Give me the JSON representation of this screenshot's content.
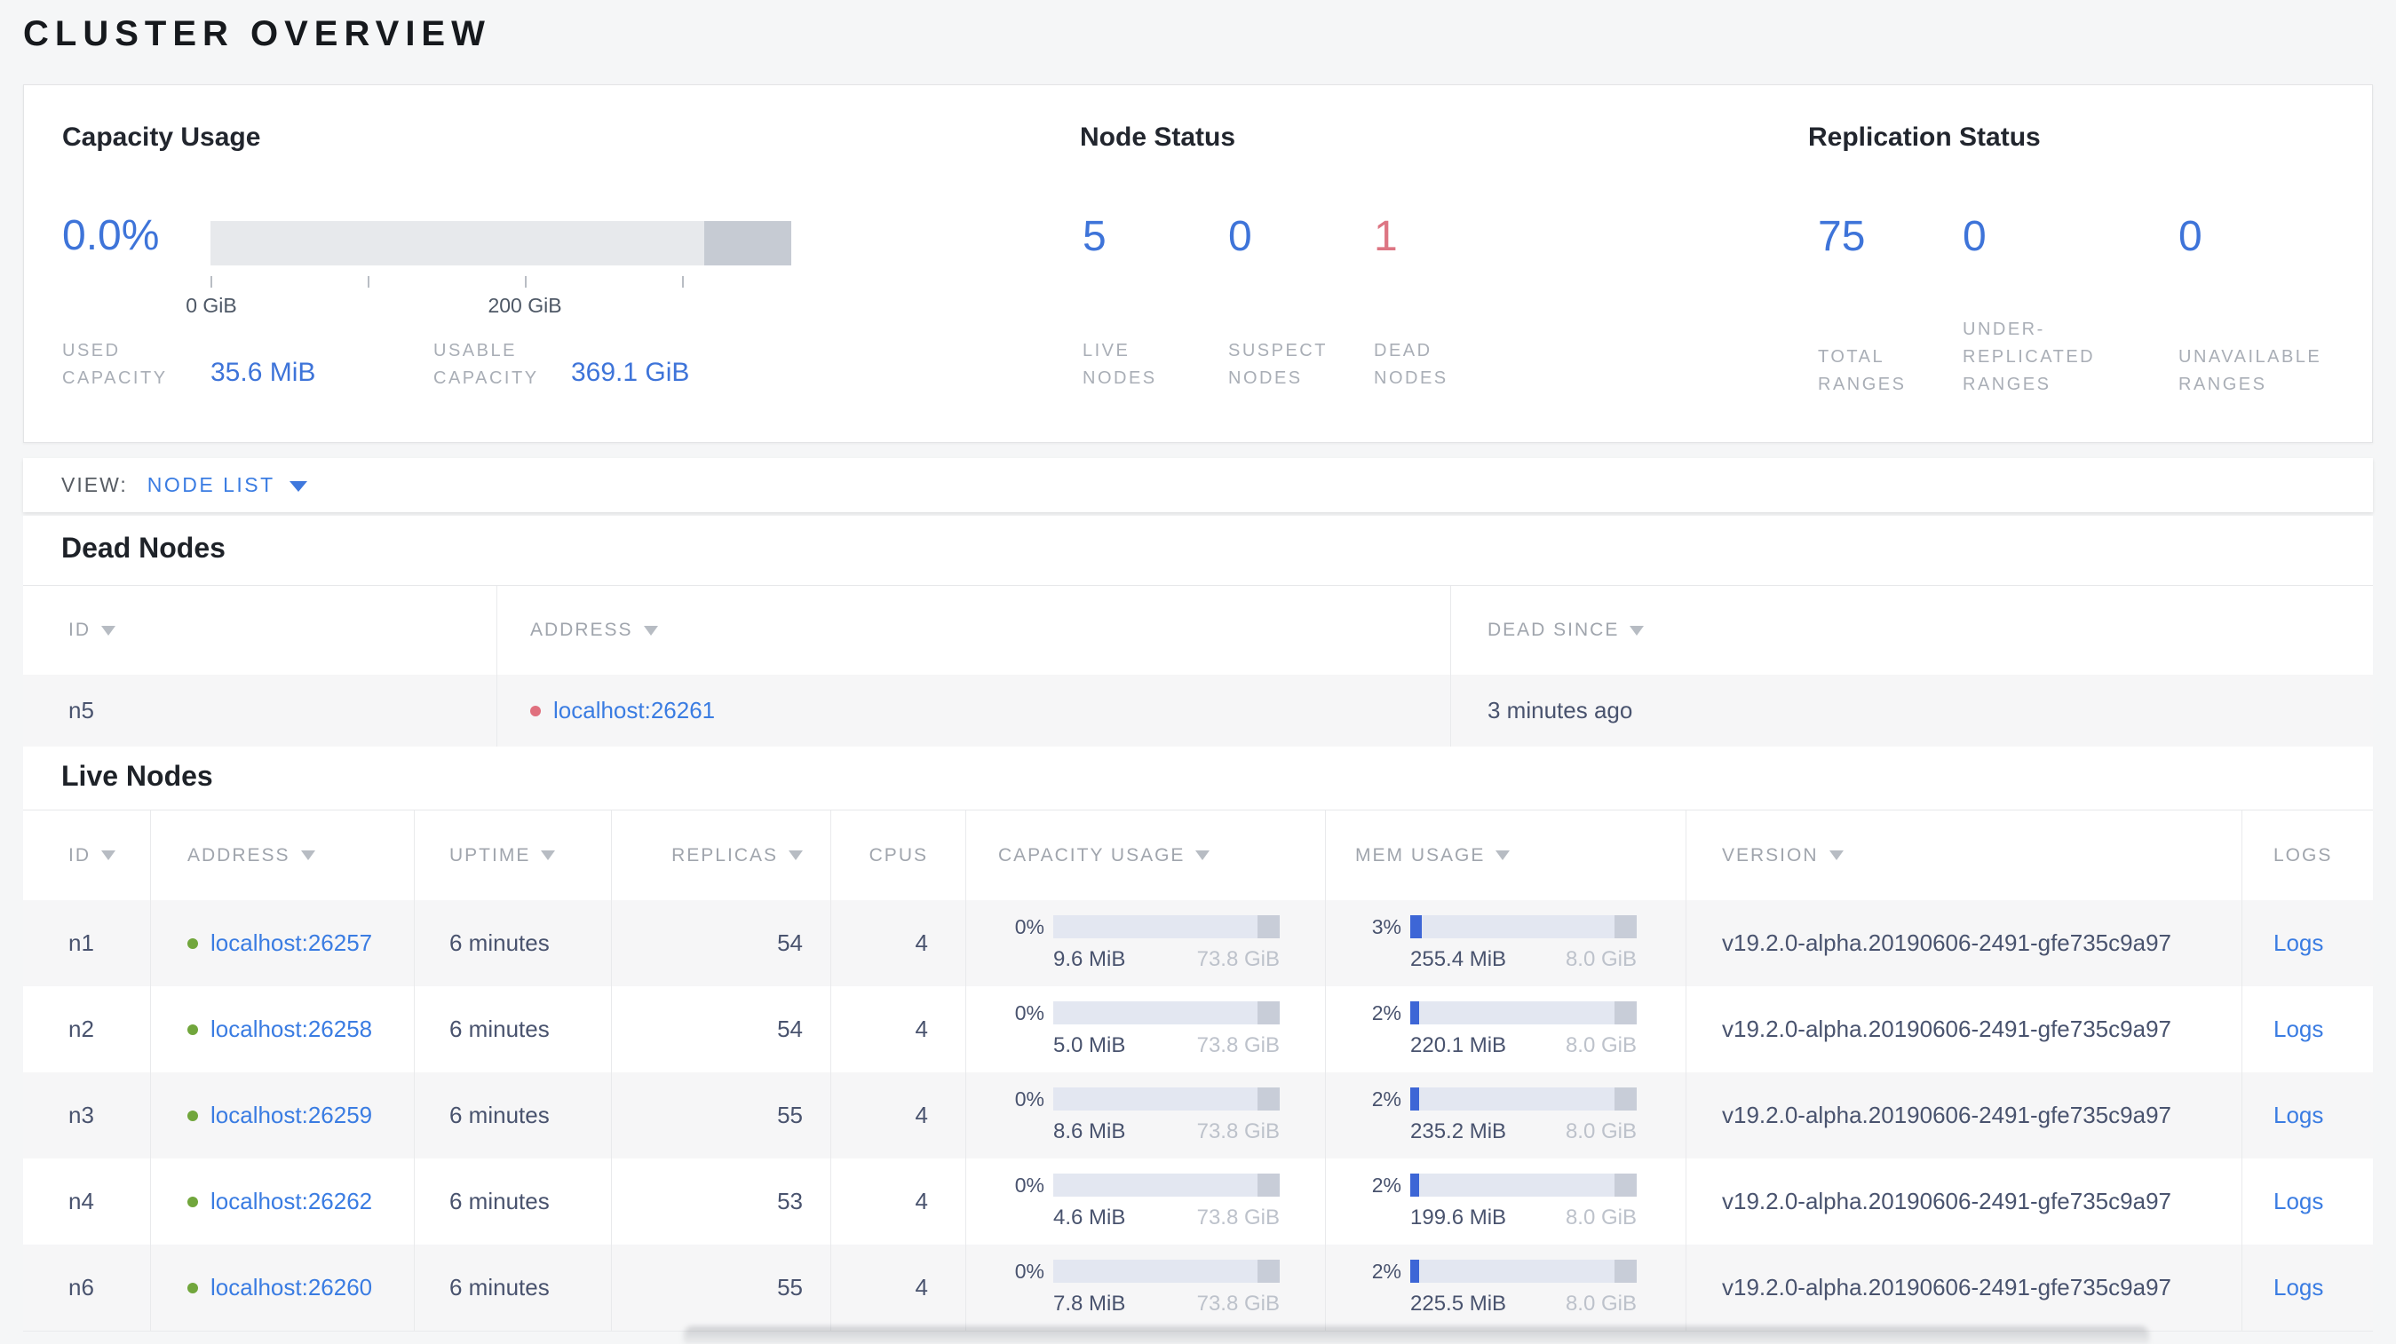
{
  "page": {
    "title": "CLUSTER OVERVIEW"
  },
  "colors": {
    "accent_blue": "#3e74d9",
    "link_blue": "#3a7ce2",
    "danger_red": "#dd7583",
    "dead_dot_red": "#e0707e",
    "live_dot_green": "#71a63c",
    "bar_track": "#e3e7f1",
    "bar_reserved_gray": "#c8cdd8",
    "bar_fill_blue": "#3d66d6"
  },
  "summary": {
    "capacity": {
      "title": "Capacity Usage",
      "percent": "0.0%",
      "tick_label_0": "0 GiB",
      "tick_label_200": "200 GiB",
      "used": {
        "word1": "USED",
        "word2": "CAPACITY",
        "value": "35.6 MiB"
      },
      "usable": {
        "word1": "USABLE",
        "word2": "CAPACITY",
        "value": "369.1 GiB"
      }
    },
    "node_status": {
      "title": "Node Status",
      "stats": [
        {
          "value": "5",
          "label": "LIVE NODES"
        },
        {
          "value": "0",
          "label": "SUSPECT NODES"
        },
        {
          "value": "1",
          "label": "DEAD NODES"
        }
      ]
    },
    "replication": {
      "title": "Replication Status",
      "stats": [
        {
          "value": "75",
          "label": "TOTAL RANGES"
        },
        {
          "value": "0",
          "label": "UNDER-REPLICATED RANGES"
        },
        {
          "value": "0",
          "label": "UNAVAILABLE RANGES"
        }
      ]
    }
  },
  "view_bar": {
    "label": "VIEW:",
    "selected": "NODE LIST"
  },
  "dead_nodes": {
    "title": "Dead Nodes",
    "columns": [
      {
        "label": "ID"
      },
      {
        "label": "ADDRESS"
      },
      {
        "label": "DEAD SINCE"
      }
    ],
    "rows": [
      {
        "id": "n5",
        "address": "localhost:26261",
        "dead_since": "3 minutes ago"
      }
    ]
  },
  "live_nodes": {
    "title": "Live Nodes",
    "columns": [
      {
        "label": "ID"
      },
      {
        "label": "ADDRESS"
      },
      {
        "label": "UPTIME"
      },
      {
        "label": "REPLICAS"
      },
      {
        "label": "CPUS"
      },
      {
        "label": "CAPACITY USAGE"
      },
      {
        "label": "MEM USAGE"
      },
      {
        "label": "VERSION"
      },
      {
        "label": "LOGS"
      }
    ],
    "rows": [
      {
        "id": "n1",
        "address": "localhost:26257",
        "uptime": "6 minutes",
        "replicas": "54",
        "cpus": "4",
        "capacity": {
          "percent": "0%",
          "fill_pct": 0,
          "used": "9.6 MiB",
          "total": "73.8 GiB"
        },
        "mem": {
          "percent": "3%",
          "fill_pct": 5,
          "used": "255.4 MiB",
          "total": "8.0 GiB"
        },
        "version": "v19.2.0-alpha.20190606-2491-gfe735c9a97",
        "logs": "Logs"
      },
      {
        "id": "n2",
        "address": "localhost:26258",
        "uptime": "6 minutes",
        "replicas": "54",
        "cpus": "4",
        "capacity": {
          "percent": "0%",
          "fill_pct": 0,
          "used": "5.0 MiB",
          "total": "73.8 GiB"
        },
        "mem": {
          "percent": "2%",
          "fill_pct": 4,
          "used": "220.1 MiB",
          "total": "8.0 GiB"
        },
        "version": "v19.2.0-alpha.20190606-2491-gfe735c9a97",
        "logs": "Logs"
      },
      {
        "id": "n3",
        "address": "localhost:26259",
        "uptime": "6 minutes",
        "replicas": "55",
        "cpus": "4",
        "capacity": {
          "percent": "0%",
          "fill_pct": 0,
          "used": "8.6 MiB",
          "total": "73.8 GiB"
        },
        "mem": {
          "percent": "2%",
          "fill_pct": 4,
          "used": "235.2 MiB",
          "total": "8.0 GiB"
        },
        "version": "v19.2.0-alpha.20190606-2491-gfe735c9a97",
        "logs": "Logs"
      },
      {
        "id": "n4",
        "address": "localhost:26262",
        "uptime": "6 minutes",
        "replicas": "53",
        "cpus": "4",
        "capacity": {
          "percent": "0%",
          "fill_pct": 0,
          "used": "4.6 MiB",
          "total": "73.8 GiB"
        },
        "mem": {
          "percent": "2%",
          "fill_pct": 4,
          "used": "199.6 MiB",
          "total": "8.0 GiB"
        },
        "version": "v19.2.0-alpha.20190606-2491-gfe735c9a97",
        "logs": "Logs"
      },
      {
        "id": "n6",
        "address": "localhost:26260",
        "uptime": "6 minutes",
        "replicas": "55",
        "cpus": "4",
        "capacity": {
          "percent": "0%",
          "fill_pct": 0,
          "used": "7.8 MiB",
          "total": "73.8 GiB"
        },
        "mem": {
          "percent": "2%",
          "fill_pct": 4,
          "used": "225.5 MiB",
          "total": "8.0 GiB"
        },
        "version": "v19.2.0-alpha.20190606-2491-gfe735c9a97",
        "logs": "Logs"
      }
    ]
  }
}
